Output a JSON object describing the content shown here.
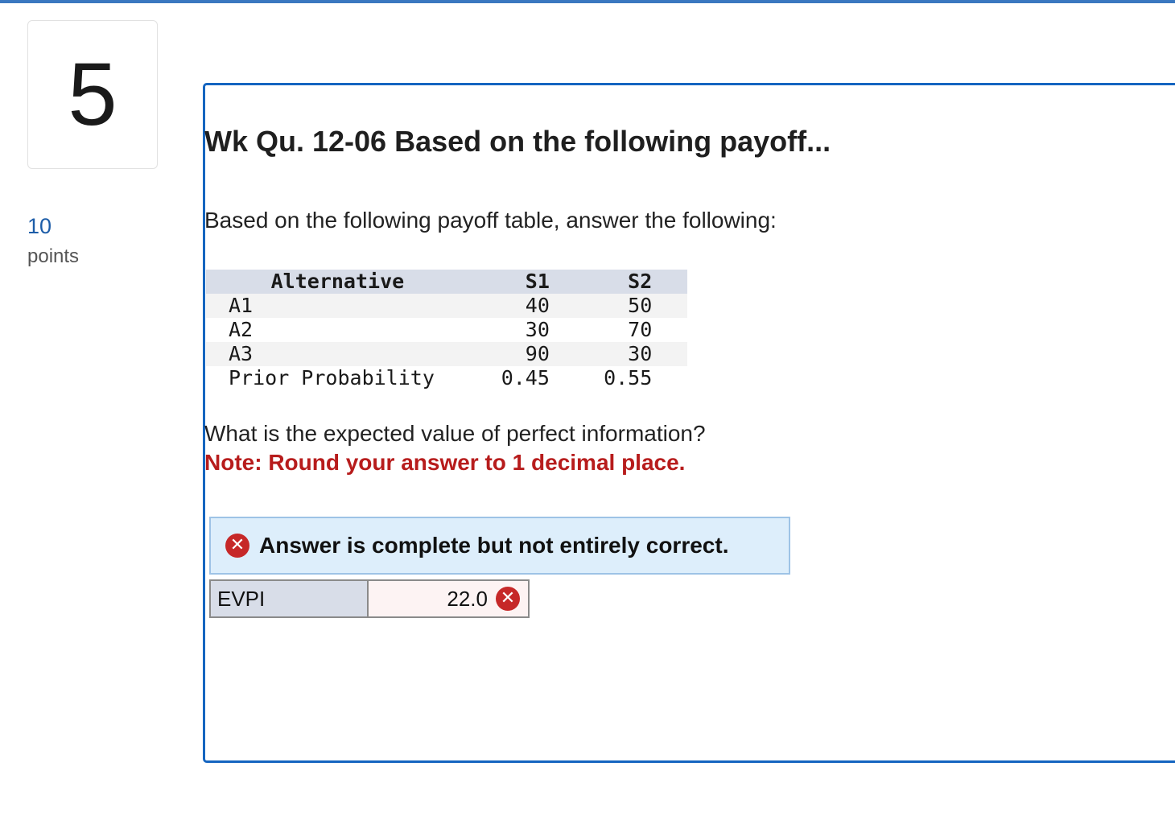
{
  "question": {
    "number": "5",
    "points_value": "10",
    "points_label": "points",
    "title": "Wk Qu. 12-06 Based on the following payoff...",
    "intro": "Based on the following payoff table, answer the following:",
    "prompt": "What is the expected value of perfect information?",
    "note": "Note: Round your answer to 1 decimal place."
  },
  "payoff_table": {
    "headers": [
      "Alternative",
      "S1",
      "S2"
    ],
    "rows": [
      {
        "alt": "A1",
        "s1": "40",
        "s2": "50"
      },
      {
        "alt": "A2",
        "s1": "30",
        "s2": "70"
      },
      {
        "alt": "A3",
        "s1": "90",
        "s2": "30"
      },
      {
        "alt": "Prior Probability",
        "s1": "0.45",
        "s2": "0.55"
      }
    ]
  },
  "result": {
    "status_icon": "x-circle-icon",
    "message": "Answer is complete but not entirely correct.",
    "error_color": "#c62828"
  },
  "answer": {
    "label": "EVPI",
    "value": "22.0",
    "status_icon": "x-circle-icon"
  },
  "colors": {
    "accent": "#1565c0",
    "note": "#b71c1c",
    "banner_bg": "#ddeefb"
  }
}
